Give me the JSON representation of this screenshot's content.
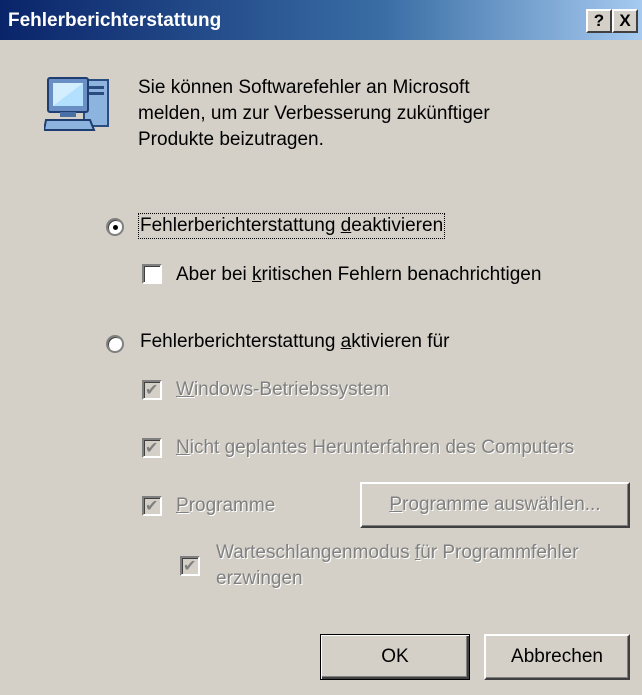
{
  "window": {
    "title": "Fehlerberichterstattung",
    "help_button": "?",
    "close_button": "X"
  },
  "intro": {
    "line1": "Sie können Softwarefehler an Microsoft",
    "line2": "melden, um zur Verbesserung zukünftiger",
    "line3": "Produkte beizutragen."
  },
  "options": {
    "disable": {
      "label_pre": "Fehlerberichterstattung ",
      "label_accel": "d",
      "label_post": "eaktivieren",
      "selected": true
    },
    "notify_critical": {
      "label_pre": "Aber bei ",
      "label_accel": "k",
      "label_post": "ritischen Fehlern benachrichtigen",
      "checked": false
    },
    "enable": {
      "label_pre": "Fehlerberichterstattung ",
      "label_accel": "a",
      "label_post": "ktivieren für",
      "selected": false
    },
    "windows_os": {
      "label_accel": "W",
      "label_post": "indows-Betriebssystem",
      "checked": true
    },
    "unplanned_shutdown": {
      "label_accel": "N",
      "label_post": "icht geplantes Herunterfahren des Computers",
      "checked": true
    },
    "programs": {
      "label_accel": "P",
      "label_post": "rogramme",
      "checked": true
    },
    "queue_mode": {
      "line1_pre": "Warteschlangenmodus ",
      "line1_accel": "f",
      "line1_post": "ür Programmfehler",
      "line2": "erzwingen",
      "checked": true
    }
  },
  "buttons": {
    "choose_programs_accel": "P",
    "choose_programs_post": "rogramme auswählen...",
    "ok": "OK",
    "cancel": "Abbrechen"
  },
  "glyphs": {
    "checkmark": "✔"
  }
}
